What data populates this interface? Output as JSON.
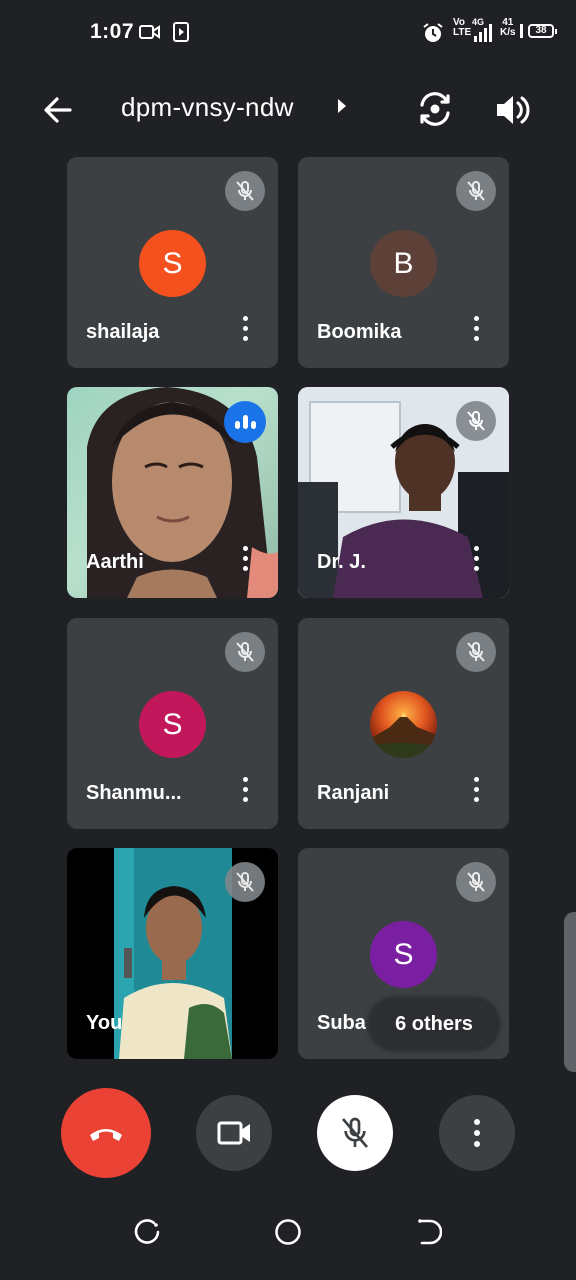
{
  "status_bar": {
    "time": "1:07",
    "network_top": "Vo",
    "network_lte": "LTE",
    "network_4g": "4G",
    "speed_value": "41",
    "speed_unit": "K/s",
    "battery": "38",
    "icons": [
      "video-camera-icon",
      "play-icon",
      "alarm-icon",
      "signal-icon",
      "battery-icon"
    ]
  },
  "top_bar": {
    "title": "dpm-vnsy-ndw",
    "icons": [
      "back-arrow-icon",
      "flip-camera-icon",
      "speaker-icon"
    ]
  },
  "participants": [
    {
      "name": "shailaja",
      "initial": "S",
      "avatar_color": "#f4511e",
      "muted": true,
      "type": "avatar"
    },
    {
      "name": "Boomika",
      "initial": "B",
      "avatar_color": "#5d4037",
      "muted": true,
      "type": "avatar"
    },
    {
      "name": "Aarthi",
      "muted": false,
      "speaking": true,
      "type": "video"
    },
    {
      "name": "Dr. J.",
      "muted": true,
      "type": "video"
    },
    {
      "name": "Shanmu...",
      "initial": "S",
      "avatar_color": "#c2185b",
      "muted": true,
      "type": "avatar"
    },
    {
      "name": "Ranjani",
      "muted": true,
      "type": "photo-avatar"
    },
    {
      "name": "You",
      "muted": true,
      "type": "video"
    },
    {
      "name": "Suba",
      "initial": "S",
      "avatar_color": "#7b1fa2",
      "muted": true,
      "type": "avatar"
    }
  ],
  "others_label": "6 others",
  "controls": {
    "end_call_color": "#ea4335",
    "icons": [
      "end-call-icon",
      "camera-icon",
      "mic-off-icon",
      "more-options-icon"
    ]
  },
  "nav_icons": [
    "recents-icon",
    "home-icon",
    "back-nav-icon"
  ]
}
